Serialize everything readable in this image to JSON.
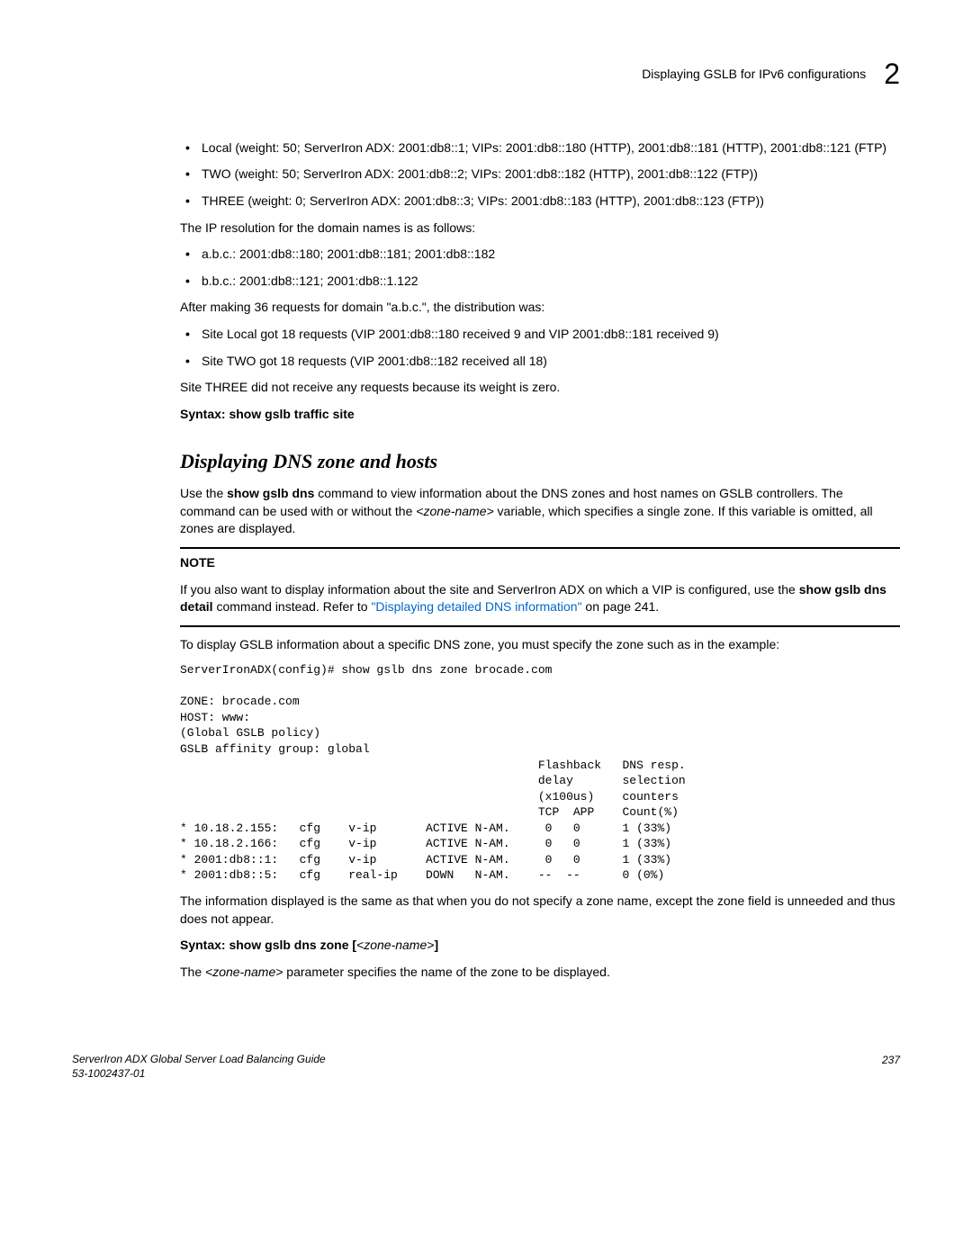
{
  "header": {
    "title": "Displaying GSLB for IPv6 configurations",
    "chapter": "2"
  },
  "bullets1": [
    "Local (weight: 50; ServerIron ADX: 2001:db8::1; VIPs: 2001:db8::180 (HTTP), 2001:db8::181 (HTTP), 2001:db8::121 (FTP)",
    "TWO (weight: 50; ServerIron ADX: 2001:db8::2; VIPs: 2001:db8::182 (HTTP), 2001:db8::122 (FTP))",
    "THREE (weight: 0; ServerIron ADX: 2001:db8::3; VIPs: 2001:db8::183 (HTTP), 2001:db8::123 (FTP))"
  ],
  "para_ipres": "The IP resolution for the domain names is as follows:",
  "bullets2": [
    "a.b.c.: 2001:db8::180; 2001:db8::181; 2001:db8::182",
    "b.b.c.: 2001:db8::121; 2001:db8::1.122"
  ],
  "para_after36": "After making 36 requests for domain \"a.b.c.\", the distribution was:",
  "bullets3": [
    "Site Local got 18 requests (VIP 2001:db8::180 received 9 and VIP 2001:db8::181 received 9)",
    "Site TWO got 18 requests (VIP 2001:db8::182 received all 18)"
  ],
  "para_three": "Site THREE did not receive any requests because its weight is zero.",
  "syntax1_prefix": "Syntax: ",
  "syntax1_cmd": "show gslb traffic site",
  "section_h": "Displaying DNS zone and hosts",
  "para_use_pre": "Use the ",
  "para_use_cmd": "show gslb dns",
  "para_use_mid": " command to view information about the DNS zones and host names on GSLB controllers. The command can be used with or without the ",
  "para_use_var": "<zone-name>",
  "para_use_end": " variable, which specifies a single zone. If this variable is omitted, all zones are displayed.",
  "note_label": "NOTE",
  "note_pre": "If you also want to display information about the site and ServerIron ADX on which a VIP is configured, use the ",
  "note_cmd": "show gslb dns detail",
  "note_mid": " command instead. Refer to ",
  "note_link": "\"Displaying detailed DNS information\"",
  "note_end": " on page 241.",
  "para_specific": "To display GSLB information about a specific DNS zone, you must specify the zone such as in the example:",
  "terminal": "ServerIronADX(config)# show gslb dns zone brocade.com\n\nZONE: brocade.com\nHOST: www:\n(Global GSLB policy)\nGSLB affinity group: global\n                                                   Flashback   DNS resp.\n                                                   delay       selection\n                                                   (x100us)    counters\n                                                   TCP  APP    Count(%)\n* 10.18.2.155:   cfg    v-ip       ACTIVE N-AM.     0   0      1 (33%)\n* 10.18.2.166:   cfg    v-ip       ACTIVE N-AM.     0   0      1 (33%)\n* 2001:db8::1:   cfg    v-ip       ACTIVE N-AM.     0   0      1 (33%)\n* 2001:db8::5:   cfg    real-ip    DOWN   N-AM.    --  --      0 (0%)",
  "para_info": "The information displayed is the same as that when you do not specify a zone name, except the zone field is unneeded and thus does not appear.",
  "syntax2_prefix": "Syntax: ",
  "syntax2_cmd": "show gslb dns zone [",
  "syntax2_var": "<zone-name>",
  "syntax2_end": "]",
  "para_zoneparam_pre": "The ",
  "para_zoneparam_var": "<zone-name>",
  "para_zoneparam_end": " parameter specifies the name of the zone to be displayed.",
  "footer": {
    "guide": "ServerIron ADX Global Server Load Balancing Guide",
    "docnum": "53-1002437-01",
    "page": "237"
  }
}
